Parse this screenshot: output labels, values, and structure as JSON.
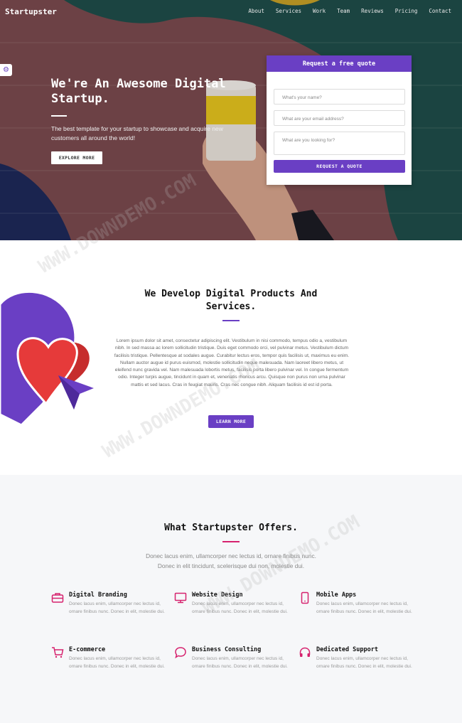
{
  "nav": {
    "brand": "Startupster",
    "links": [
      "About",
      "Services",
      "Work",
      "Team",
      "Reviews",
      "Pricing",
      "Contact"
    ]
  },
  "hero": {
    "title": "We're An Awesome Digital Startup.",
    "subtitle": "The best template for your startup to showcase and acquire new customers all around the world!",
    "button_label": "EXPLORE MORE"
  },
  "quote_form": {
    "heading": "Request a free quote",
    "name_placeholder": "What's your name?",
    "email_placeholder": "What are your email address?",
    "message_placeholder": "What are you looking for?",
    "button_label": "REQUEST A QUOTE"
  },
  "develop": {
    "title": "We Develop Digital Products And Services.",
    "body": "Lorem ipsum dolor sit amet, consectetur adipiscing elit. Vestibulum in nisi commodo, tempus odio a, vestibulum nibh. In sed massa ac lorem sollicitudin tristique. Duis eget commodo orci, vel pulvinar metus. Vestibulum dictum facilisis tristique. Pellentesque at sodales augue. Curabitur lectus eros, tempor quis facilisis ut, maximus eu enim. Nullam auctor augue id purus euismod, molestie sollicitudin neque malesuada. Nam laoreet libero metus, ut eleifend nunc gravida vel. Nam malesuada lobortis metus, facilisis porta libero pulvinar vel. In congue fermentum odio. Integer turpis augue, tincidunt in quam et, venenatis rhoncus arcu. Quisque non purus non urna pulvinar mattis et sed lacus. Cras in feugiat mauris. Cras nec congue nibh. Aliquam facilisis id est id porta.",
    "button_label": "LEARN MORE"
  },
  "offers": {
    "title": "What Startupster Offers.",
    "subtitle": "Donec lacus enim, ullamcorper nec lectus id, ornare finibus nunc. Donec in elit tincidunt, scelerisque dui non, molestie dui.",
    "items": [
      {
        "title": "Digital Branding",
        "desc": "Donec lacus enim, ullamcorper nec lectus id, ornare finibus nunc. Donec in elit, molestie dui.",
        "icon": "briefcase-icon"
      },
      {
        "title": "Website Design",
        "desc": "Donec lacus enim, ullamcorper nec lectus id, ornare finibus nunc. Donec in elit, molestie dui.",
        "icon": "monitor-icon"
      },
      {
        "title": "Mobile Apps",
        "desc": "Donec lacus enim, ullamcorper nec lectus id, ornare finibus nunc. Donec in elit, molestie dui.",
        "icon": "mobile-icon"
      },
      {
        "title": "E-commerce",
        "desc": "Donec lacus enim, ullamcorper nec lectus id, ornare finibus nunc. Donec in elit, molestie dui.",
        "icon": "cart-icon"
      },
      {
        "title": "Business Consulting",
        "desc": "Donec lacus enim, ullamcorper nec lectus id, ornare finibus nunc. Donec in elit, molestie dui.",
        "icon": "chat-icon"
      },
      {
        "title": "Dedicated Support",
        "desc": "Donec lacus enim, ullamcorper nec lectus id, ornare finibus nunc. Donec in elit, molestie dui.",
        "icon": "headphones-icon"
      }
    ]
  },
  "watermark": "WWW.DOWNDEMO.COM",
  "colors": {
    "accent": "#6a3fc4",
    "pink_accent": "#d6226e",
    "hero_overlay": "#7a4a4c"
  }
}
